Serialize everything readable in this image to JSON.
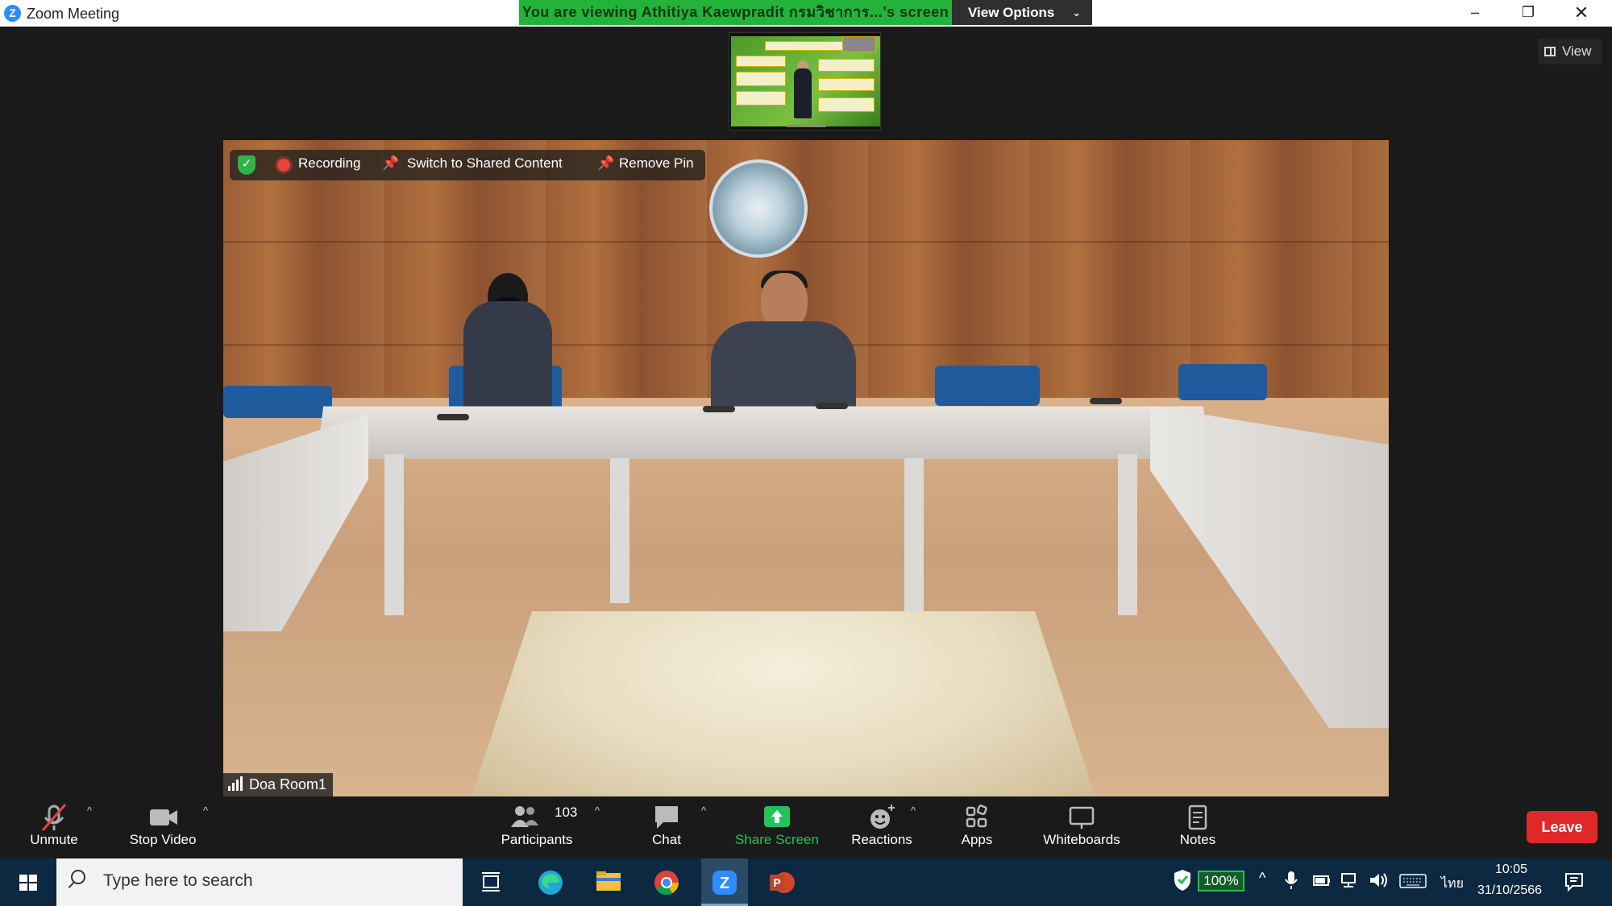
{
  "window": {
    "title": "Zoom Meeting",
    "viewing_banner": "You  are  viewing  Athitiya  Kaewpradit  กรมวิชาการ...'s screen",
    "view_options_label": "View Options",
    "view_button_label": "View"
  },
  "video": {
    "recording_label": "Recording",
    "switch_label": "Switch to Shared Content",
    "remove_pin_label": "Remove Pin",
    "participant_name": "Doa Room1"
  },
  "toolbar": {
    "unmute": "Unmute",
    "stop_video": "Stop Video",
    "participants_count": "103",
    "participants": "Participants",
    "chat": "Chat",
    "share_screen": "Share Screen",
    "reactions": "Reactions",
    "apps": "Apps",
    "whiteboards": "Whiteboards",
    "notes": "Notes",
    "leave": "Leave"
  },
  "taskbar": {
    "search_placeholder": "Type here to search",
    "battery": "100%",
    "language": "ไทย",
    "time": "10:05",
    "date": "31/10/2566"
  },
  "colors": {
    "banner_green": "#23b33b",
    "share_green": "#23c35a",
    "leave_red": "#e02828",
    "recording_red": "#e8433b"
  }
}
